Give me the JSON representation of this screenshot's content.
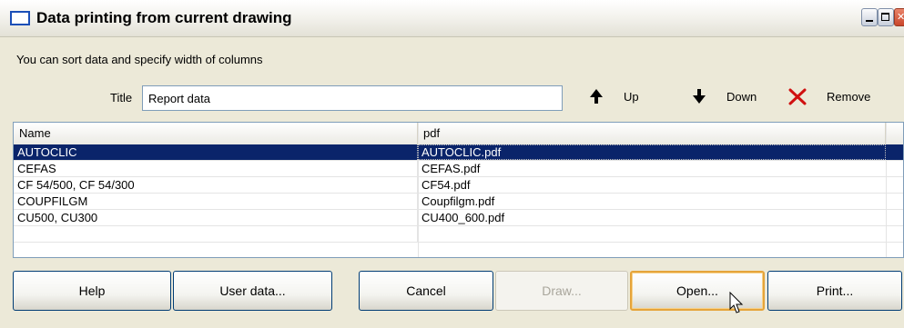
{
  "window": {
    "title": "Data printing from current drawing",
    "controls": [
      "minimize",
      "maximize",
      "close"
    ]
  },
  "instruction": "You can sort data and specify width of columns",
  "title_field": {
    "label": "Title",
    "value": "Report data"
  },
  "toolbar": {
    "up_label": "Up",
    "down_label": "Down",
    "remove_label": "Remove",
    "icons": {
      "up": "arrow-up-icon",
      "down": "arrow-down-icon",
      "remove": "red-x-icon"
    },
    "remove_color": "#d01010"
  },
  "grid": {
    "columns": [
      "Name",
      "pdf"
    ],
    "rows": [
      {
        "name": "AUTOCLIC",
        "pdf": "AUTOCLIC.pdf",
        "selected": true
      },
      {
        "name": "CEFAS",
        "pdf": "CEFAS.pdf"
      },
      {
        "name": "CF 54/500, CF 54/300",
        "pdf": "CF54.pdf"
      },
      {
        "name": "COUPFILGM",
        "pdf": "Coupfilgm.pdf"
      },
      {
        "name": "CU500, CU300",
        "pdf": "CU400_600.pdf"
      }
    ],
    "selection_color": "#0a246a"
  },
  "buttons": {
    "help": "Help",
    "user_data": "User data...",
    "cancel": "Cancel",
    "draw": "Draw...",
    "open": "Open...",
    "print": "Print..."
  }
}
